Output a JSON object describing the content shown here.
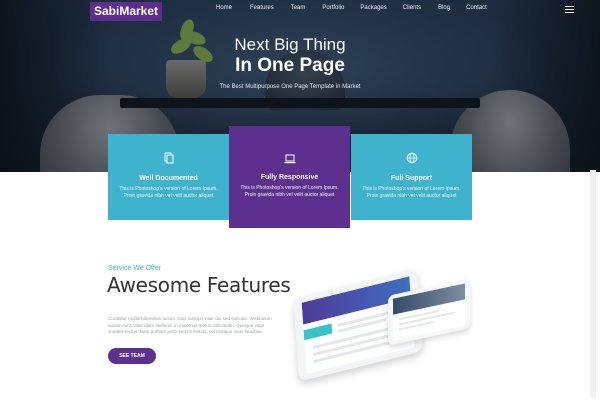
{
  "brand": {
    "logo": "SabiMarket"
  },
  "nav": {
    "items": [
      "Home",
      "Features",
      "Team",
      "Portfolio",
      "Packages",
      "Clients",
      "Blog",
      "Contact"
    ]
  },
  "hero": {
    "title_line1": "Next Big Thing",
    "title_line2": "In One Page",
    "subtitle": "The Best Multipurpose One Page Template in Market"
  },
  "cards": [
    {
      "icon": "document-icon",
      "title": "Well Documented",
      "text": "This is Photoshop's version of Lorem Ipsum. Proin gravida nibh vel velit auctor aliquet"
    },
    {
      "icon": "laptop-icon",
      "title": "Fully Responsive",
      "text": "This is Photoshop's version of Lorem Ipsum. Proin gravida nibh vel velit auctor aliquet"
    },
    {
      "icon": "globe-icon",
      "title": "Full Support",
      "text": "This is Photoshop's version of Lorem Ipsum. Proin gravida nibh vel velit auctor aliquet"
    }
  ],
  "features": {
    "eyebrow": "Service We Offer",
    "title": "Awesome Features",
    "text": "Curabitur mollis bibendum luctus. Duis suscipit vitae dui sed suscipit. Vestibulum auctor nunc vitae diam eleifend, in maximus metus sollicitudin. Quisque vitae sodales lectus. Nam porttitor justo sed mi finibus, vel tristique risus faucibus.",
    "button": "SEE TEAM"
  },
  "colors": {
    "purple": "#5d2f8f",
    "teal": "#3fb3cd",
    "hero_bg": "#1d2c3f"
  }
}
